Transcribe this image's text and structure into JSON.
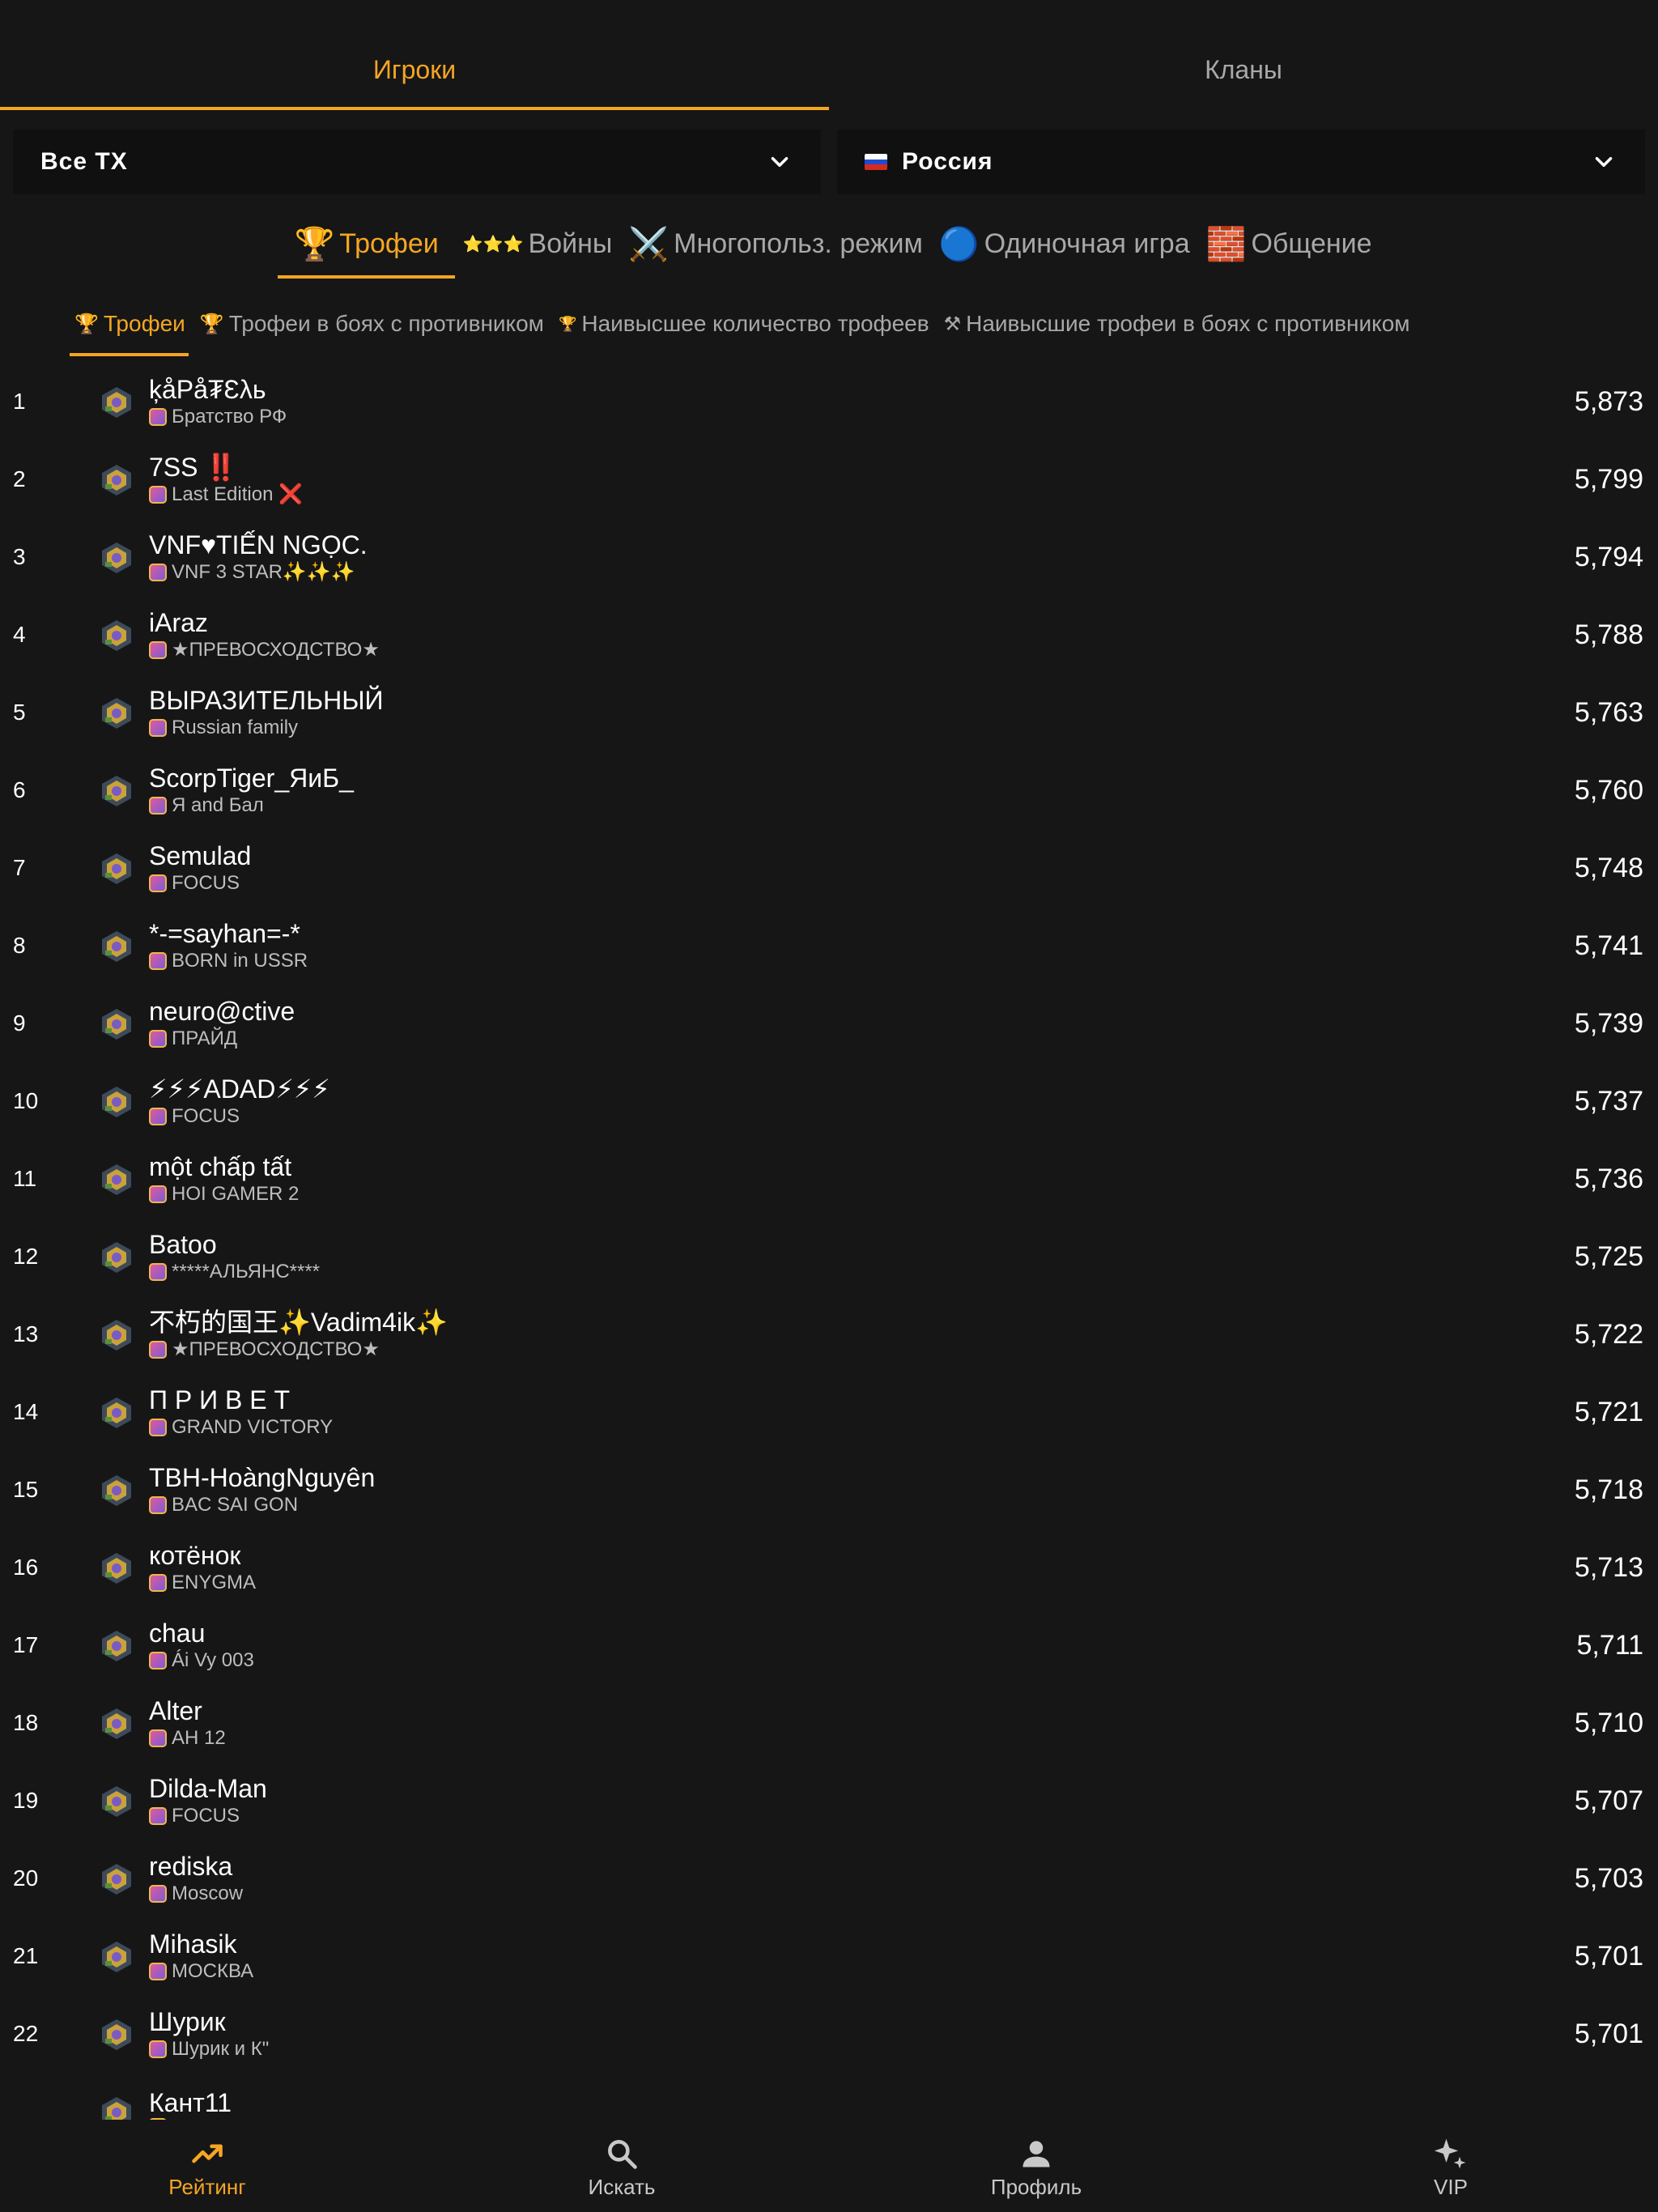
{
  "top_tabs": [
    {
      "label": "Игроки",
      "active": true
    },
    {
      "label": "Кланы",
      "active": false
    }
  ],
  "filters": {
    "hall": "Все ТХ",
    "country": "Россия"
  },
  "category_tabs": [
    {
      "icon": "🏆",
      "label": "Трофеи",
      "active": true
    },
    {
      "icon": "⭐⭐⭐",
      "label": "Войны",
      "active": false
    },
    {
      "icon": "⚔️",
      "label": "Многопольз. режим",
      "active": false
    },
    {
      "icon": "🔵",
      "label": "Одиночная игра",
      "active": false
    },
    {
      "icon": "🧱",
      "label": "Общение",
      "active": false
    }
  ],
  "sub_tabs": [
    {
      "icon": "🏆",
      "label": "Трофеи",
      "active": true
    },
    {
      "icon": "🏆",
      "label": "Трофеи в боях с противником",
      "active": false
    },
    {
      "icon": "🏆",
      "label": "Наивысшее количество трофеев",
      "active": false
    },
    {
      "icon": "⚒",
      "label": "Наивысшие трофеи в боях с противником",
      "active": false
    }
  ],
  "players": [
    {
      "rank": "1",
      "name": "ķåPå₮Ɛλь",
      "clan": "Братство РФ",
      "trophies": "5,873"
    },
    {
      "rank": "2",
      "name": "7SS ‼️",
      "clan": "Last Edition ❌",
      "trophies": "5,799"
    },
    {
      "rank": "3",
      "name": "VNF♥TIẾN NGỌC.",
      "clan": "VNF 3 STAR✨✨✨",
      "trophies": "5,794"
    },
    {
      "rank": "4",
      "name": "iAraz",
      "clan": "★ПРЕВОСХОДСТВО★",
      "trophies": "5,788"
    },
    {
      "rank": "5",
      "name": "ВЫРАЗИТЕЛЬНЫЙ",
      "clan": "Russian family",
      "trophies": "5,763"
    },
    {
      "rank": "6",
      "name": "ScorpTiger_ЯиБ_",
      "clan": "Я and Бал",
      "trophies": "5,760"
    },
    {
      "rank": "7",
      "name": "Semulad",
      "clan": "FOCUS",
      "trophies": "5,748"
    },
    {
      "rank": "8",
      "name": "*-=sayhan=-*",
      "clan": "BORN in USSR",
      "trophies": "5,741"
    },
    {
      "rank": "9",
      "name": "neuro@ctive",
      "clan": "ПРАЙД",
      "trophies": "5,739"
    },
    {
      "rank": "10",
      "name": "⚡⚡⚡ADAD⚡⚡⚡",
      "clan": "FOCUS",
      "trophies": "5,737"
    },
    {
      "rank": "11",
      "name": "một chấp tất",
      "clan": "HOI GAMER 2",
      "trophies": "5,736"
    },
    {
      "rank": "12",
      "name": "Batoo",
      "clan": "*****АЛЬЯНС****",
      "trophies": "5,725"
    },
    {
      "rank": "13",
      "name": "不朽的国王✨Vadim4ik✨",
      "clan": "★ПРЕВОСХОДСТВО★",
      "trophies": "5,722"
    },
    {
      "rank": "14",
      "name": "П Р И В Е Т",
      "clan": "GRAND VICTORY",
      "trophies": "5,721"
    },
    {
      "rank": "15",
      "name": "TBH-HoàngNguyên",
      "clan": "BAC SAI GON",
      "trophies": "5,718"
    },
    {
      "rank": "16",
      "name": "котёнок",
      "clan": "ENYGMA",
      "trophies": "5,713"
    },
    {
      "rank": "17",
      "name": "chau",
      "clan": "Ái Vy 003",
      "trophies": "5,711"
    },
    {
      "rank": "18",
      "name": "Alter",
      "clan": "AH 12",
      "trophies": "5,710"
    },
    {
      "rank": "19",
      "name": "Dilda-Man",
      "clan": "FOCUS",
      "trophies": "5,707"
    },
    {
      "rank": "20",
      "name": "rediska",
      "clan": "Moscow",
      "trophies": "5,703"
    },
    {
      "rank": "21",
      "name": "Mihasik",
      "clan": "МОСКВА",
      "trophies": "5,701"
    },
    {
      "rank": "22",
      "name": "Шурик",
      "clan": "Шурик и К\"",
      "trophies": "5,701"
    },
    {
      "rank": "",
      "name": "Кант11",
      "clan": "",
      "trophies": ""
    }
  ],
  "bottom_nav": [
    {
      "label": "Рейтинг",
      "icon": "trending-up-icon",
      "active": true
    },
    {
      "label": "Искать",
      "icon": "search-icon",
      "active": false
    },
    {
      "label": "Профиль",
      "icon": "person-icon",
      "active": false
    },
    {
      "label": "VIP",
      "icon": "sparkles-icon",
      "active": false
    }
  ],
  "colors": {
    "accent": "#f5a623",
    "background": "#161616",
    "dropdown_bg": "#101010",
    "muted_text": "#a8a8a8"
  }
}
